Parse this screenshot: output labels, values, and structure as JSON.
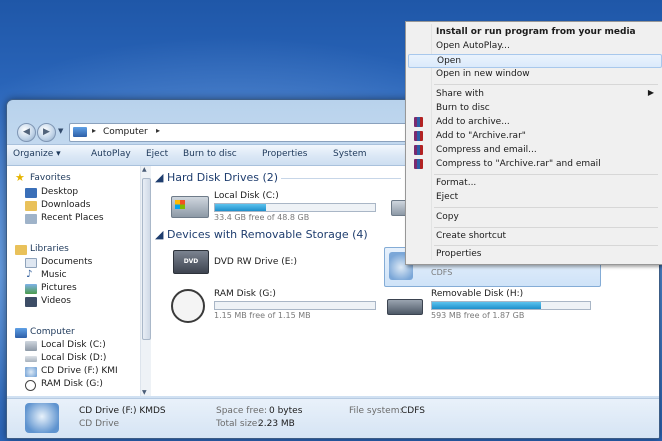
{
  "window": {
    "address_crumb": "Computer",
    "toolbar": [
      "Organize ▾",
      "AutoPlay",
      "Eject",
      "Burn to disc",
      "Properties",
      "System"
    ]
  },
  "navigation": {
    "favorites": "Favorites",
    "fav_items": [
      "Desktop",
      "Downloads",
      "Recent Places"
    ],
    "libraries": "Libraries",
    "lib_items": [
      "Documents",
      "Music",
      "Pictures",
      "Videos"
    ],
    "computer": "Computer",
    "comp_items": [
      "Local Disk (C:)",
      "Local Disk (D:)",
      "CD Drive (F:) KMI",
      "RAM Disk (G:)"
    ]
  },
  "content": {
    "group_hdd": "Hard Disk Drives (2)",
    "group_removable": "Devices with Removable Storage (4)",
    "drives": {
      "c": {
        "name": "Local Disk (C:)",
        "free": "33.4 GB free of 48.8 GB",
        "used_fraction": 0.32
      },
      "dvd": {
        "name": "DVD RW Drive (E:)",
        "icon_text": "DVD"
      },
      "cd": {
        "fs": "CDFS"
      },
      "ram": {
        "name": "RAM Disk (G:)",
        "free": "1.15 MB free of 1.15 MB",
        "used_fraction": 0.0
      },
      "removable": {
        "name": "Removable Disk (H:)",
        "free": "593 MB free of 1.87 GB",
        "used_fraction": 0.69
      }
    }
  },
  "details": {
    "name": "CD Drive (F:) KMDS",
    "type": "CD Drive",
    "space_free_label": "Space free:",
    "space_free_value": "0 bytes",
    "total_size_label": "Total size:",
    "total_size_value": "2.23 MB",
    "fs_label": "File system:",
    "fs_value": "CDFS"
  },
  "context_menu": {
    "items": [
      "Install or run program from your media",
      "Open AutoPlay...",
      "Open",
      "Open in new window",
      "Share with",
      "Burn to disc",
      "Add to archive...",
      "Add to \"Archive.rar\"",
      "Compress and email...",
      "Compress to \"Archive.rar\" and email",
      "Format...",
      "Eject",
      "Copy",
      "Create shortcut",
      "Properties"
    ]
  }
}
